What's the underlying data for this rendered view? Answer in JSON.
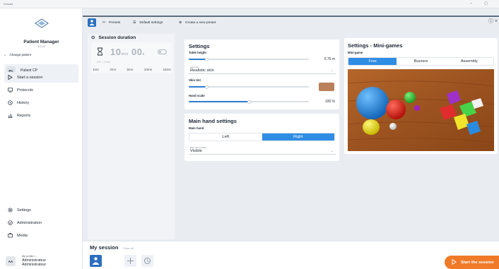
{
  "window": {
    "title": "Virtuals",
    "controls": "– ▢"
  },
  "sidebar": {
    "title": "Patient Manager",
    "version": "3.0.11",
    "change_patient": "Change patient",
    "patient": {
      "initials": "PC",
      "name": "Patient CP"
    },
    "nav": [
      {
        "label": "Start a session",
        "icon": "play-icon"
      },
      {
        "label": "Protocols",
        "icon": "protocols-icon"
      },
      {
        "label": "History",
        "icon": "history-icon"
      },
      {
        "label": "Reports",
        "icon": "reports-icon"
      }
    ],
    "bottom_nav": [
      {
        "label": "Settings",
        "icon": "gear-icon"
      },
      {
        "label": "Administration",
        "icon": "shield-icon"
      },
      {
        "label": "Media",
        "icon": "media-icon"
      }
    ],
    "profile": {
      "initials": "AA",
      "link": "My profile >",
      "name": "Administrateur",
      "role": "Administrateur"
    }
  },
  "topbar": {
    "presets": "Presets",
    "default_settings": "Default settings",
    "create_preset": "Create a new preset"
  },
  "session": {
    "title": "Session duration",
    "timer_minutes": "10",
    "timer_seconds": "00",
    "timer_min_unit": "min",
    "timer_sec_unit": "s",
    "subline": "0% + 0min",
    "presets": [
      "1mn",
      "3mn",
      "5mn",
      "10mn",
      "15mn"
    ]
  },
  "settings": {
    "title": "Settings",
    "table_height_label": "Table height",
    "table_height_value": "0.76 m",
    "table_height_level": 0.15,
    "hand_skin_caption": "Hand skin",
    "hand_skin_value": "Realistic skin",
    "skin_tint_label": "Skin tint",
    "skin_tint_level": 0.15,
    "skin_tint_color": "#b9805a",
    "hand_scale_label": "Hand scale",
    "hand_scale_value": "100 %",
    "hand_scale_level": 0.5
  },
  "main_hand": {
    "title": "Main hand settings",
    "label": "Main hand",
    "options": [
      "Left",
      "Right"
    ],
    "selected": "Right",
    "visibility_caption": "Main hand visibility",
    "visibility_value": "Visible"
  },
  "mini_games": {
    "title": "Settings - Mini-games",
    "label": "Mini-game",
    "tabs": [
      "Free",
      "Buzzers",
      "Assembly"
    ],
    "selected": "Free"
  },
  "bottom": {
    "title": "My session",
    "clear_all": "Clear all",
    "start_label": "Start the session"
  },
  "colors": {
    "accent": "#2f8de4",
    "start": "#f07a28",
    "brand": "#2c6fbe"
  }
}
